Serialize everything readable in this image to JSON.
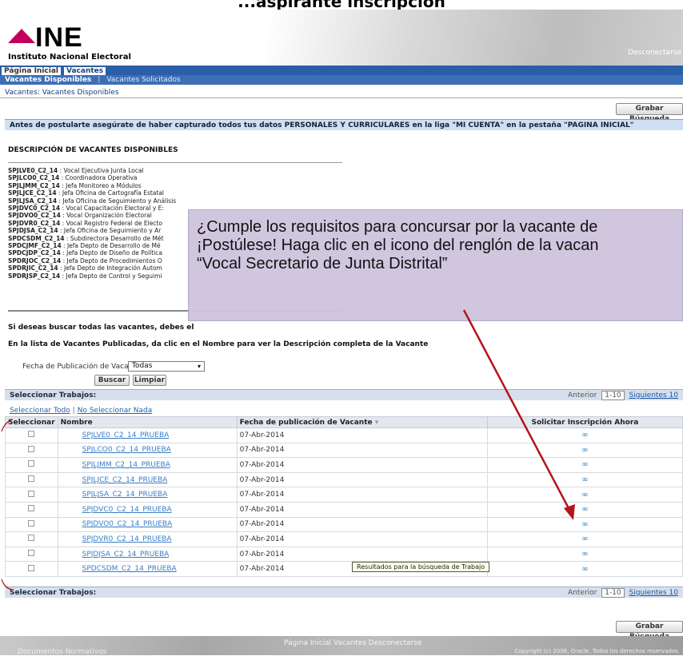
{
  "slide_caption": "...aspirante inscripción",
  "header": {
    "logo_text": "INE",
    "logo_subtitle": "Instituto Nacional Electoral",
    "disconnect": "Desconectarse"
  },
  "tabs": [
    {
      "label": "Página Inicial"
    },
    {
      "label": "Vacantes"
    }
  ],
  "subtabs": {
    "active": "Vacantes Disponibles",
    "separator": "|",
    "inactive": "Vacantes Solicitados"
  },
  "breadcrumb": "Vacantes: Vacantes Disponibles",
  "save_search_label": "Grabar Búsqueda",
  "notice": "Antes de postularte asegúrate de haber capturado todos tus datos PERSONALES Y CURRICULARES en la liga \"MI CUENTA\" en la pestaña \"PAGINA INICIAL\"",
  "descriptions": {
    "title": "DESCRIPCIÓN DE VACANTES DISPONIBLES",
    "items": [
      {
        "code": "SPJLVE0_C2_14",
        "text": " : Vocal Ejecutiva Junta Local"
      },
      {
        "code": "SPJLCO0_C2_14",
        "text": " : Coordinadora Operativa"
      },
      {
        "code": "SPJLJMM_C2_14",
        "text": " : Jefa Monitoreo a Módulos"
      },
      {
        "code": "SPJLJCE_C2_14",
        "text": " : Jefa Oficina de Cartografía Estatal"
      },
      {
        "code": "SPJLJSA_C2_14",
        "text": " : Jefa Oficina de Seguimiento y Análisis"
      },
      {
        "code": "SPJDVC0_C2_14",
        "text": " : Vocal Capacitación Electoral y E:"
      },
      {
        "code": "SPJDVO0_C2_14",
        "text": " : Vocal Organización Electoral"
      },
      {
        "code": "SPJDVR0_C2_14",
        "text": " : Vocal Registro Federal de Electo"
      },
      {
        "code": "SPJDJSA_C2_14",
        "text": " : Jefa Oficina de Seguimiento y Ar"
      },
      {
        "code": "SPDCSDM_C2_14",
        "text": " : Subdirectora Desarrollo de Mét"
      },
      {
        "code": "SPDCJMF_C2_14",
        "text": " : Jefa Depto de Desarrollo de Mé"
      },
      {
        "code": "SPDCJDP_C2_14",
        "text": " : Jefa Depto de Diseño de Política"
      },
      {
        "code": "SPDRJOC_C2_14",
        "text": " : Jefa Depto de Procedimientos O"
      },
      {
        "code": "SPDRJIC_C2_14",
        "text": " : Jefa Depto de Integración Autom"
      },
      {
        "code": "SPDRJSP_C2_14",
        "text": " : Jefa Depto de Control y Seguimi"
      }
    ]
  },
  "callout": {
    "line1": "¿Cumple los requisitos para concursar por la vacante de",
    "line2": "¡Postúlese! Haga clic en el icono del renglón de la vacan",
    "line3": "“Vocal Secretario de Junta Distrital”"
  },
  "search_note": "Si deseas buscar todas las vacantes, debes el",
  "list_note": "En la lista de Vacantes Publicadas, da clic en el Nombre para ver la Descripción completa de la Vacante",
  "filter": {
    "label": "Fecha de Publicación de Vacante",
    "value": "Todas",
    "search_button": "Buscar",
    "clear_button": "Limpiar"
  },
  "table_bar": {
    "label": "Seleccionar Trabajos:",
    "prev": "Anterior",
    "range": "1-10",
    "next": "Siguientes 10"
  },
  "select_links": {
    "all": "Seleccionar Todo",
    "sep": "|",
    "none": "No Seleccionar Nada"
  },
  "columns": {
    "select": "Seleccionar",
    "name": "Nombre",
    "date": "Fecha de publicación de Vacante",
    "apply": "Solicitar Inscripción Ahora"
  },
  "rows": [
    {
      "name": "SPJLVE0_C2_14_PRUEBA",
      "date": "07-Abr-2014"
    },
    {
      "name": "SPJLCO0_C2_14_PRUEBA",
      "date": "07-Abr-2014"
    },
    {
      "name": "SPJLJMM_C2_14_PRUEBA",
      "date": "07-Abr-2014"
    },
    {
      "name": "SPJLJCE_C2_14_PRUEBA",
      "date": "07-Abr-2014"
    },
    {
      "name": "SPJLJSA_C2_14_PRUEBA",
      "date": "07-Abr-2014"
    },
    {
      "name": "SPJDVC0_C2_14_PRUEBA",
      "date": "07-Abr-2014"
    },
    {
      "name": "SPJDVO0_C2_14_PRUEBA",
      "date": "07-Abr-2014"
    },
    {
      "name": "SPJDVR0_C2_14_PRUEBA",
      "date": "07-Abr-2014"
    },
    {
      "name": "SPJDJSA_C2_14_PRUEBA",
      "date": "07-Abr-2014"
    },
    {
      "name": "SPDCSDM_C2_14_PRUEBA",
      "date": "07-Abr-2014"
    }
  ],
  "apply_icon": "binoculars-icon",
  "tooltip": "Resultados para la búsqueda de Trabajo",
  "footer": {
    "nav": "Página Inicial   Vacantes   Desconectarse",
    "docs": "Documentos Normativos",
    "copyright": "Copyright (c) 2006, Oracle. Todos los derechos reservados."
  },
  "colors": {
    "tab_bar": "#2a5ea8",
    "brand": "#c2005b",
    "callout_bg": "#cec5de",
    "arrow": "#b3151b",
    "link": "#3b7ec5"
  }
}
